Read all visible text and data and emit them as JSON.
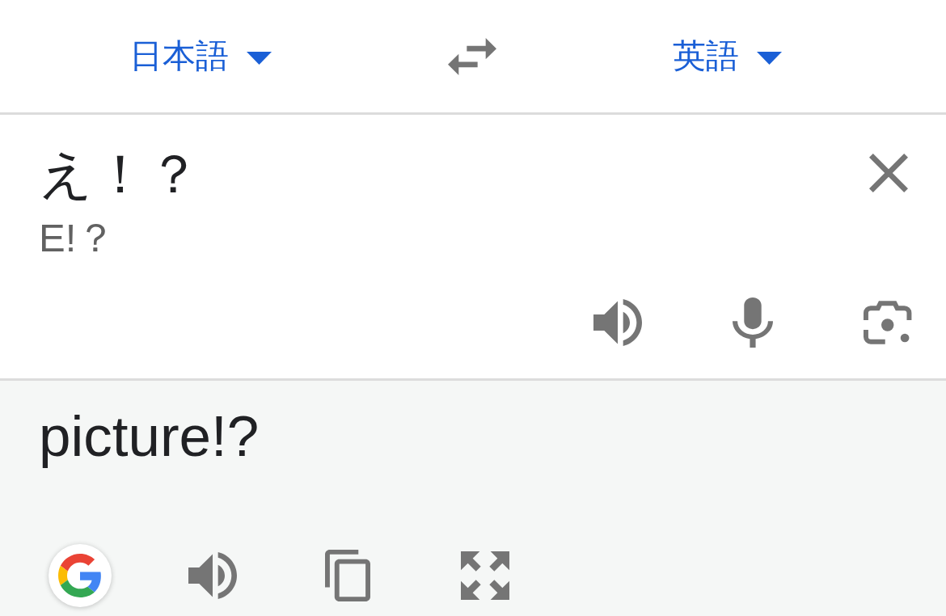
{
  "language_bar": {
    "source_language": "日本語",
    "target_language": "英語"
  },
  "source": {
    "text": "え！？",
    "romanization": "E!？"
  },
  "translation": {
    "text": "picture!?"
  }
}
